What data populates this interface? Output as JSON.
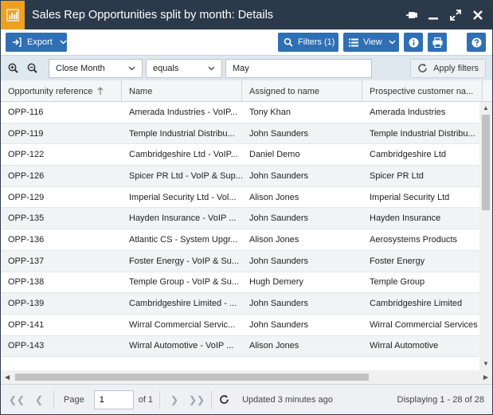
{
  "window": {
    "title": "Sales Rep Opportunities split by month: Details"
  },
  "toolbar": {
    "export_label": "Export",
    "filters_label": "Filters (1)",
    "view_label": "View"
  },
  "filter": {
    "field": "Close Month",
    "operator": "equals",
    "value": "May",
    "apply_label": "Apply filters"
  },
  "grid": {
    "columns": [
      "Opportunity reference",
      "Name",
      "Assigned to name",
      "Prospective customer na..."
    ],
    "rows": [
      [
        "OPP-116",
        "Amerada Industries - VoIP...",
        "Tony Khan",
        "Amerada Industries"
      ],
      [
        "OPP-119",
        "Temple Industrial Distribu...",
        "John Saunders",
        "Temple Industrial Distribu..."
      ],
      [
        "OPP-122",
        "Cambridgeshire Ltd - VoIP...",
        "Daniel Demo",
        "Cambridgeshire Ltd"
      ],
      [
        "OPP-126",
        "Spicer PR Ltd - VoIP & Sup...",
        "John Saunders",
        "Spicer PR Ltd"
      ],
      [
        "OPP-129",
        "Imperial Security Ltd - Vol...",
        "Alison Jones",
        "Imperial Security Ltd"
      ],
      [
        "OPP-135",
        "Hayden Insurance - VoIP ...",
        "John Saunders",
        "Hayden Insurance"
      ],
      [
        "OPP-136",
        "Atlantic CS - System Upgr...",
        "Alison Jones",
        "Aerosystems Products"
      ],
      [
        "OPP-137",
        "Foster Energy - VoIP & Su...",
        "John Saunders",
        "Foster Energy"
      ],
      [
        "OPP-138",
        "Temple Group - VoIP & Su...",
        "Hugh Demery",
        "Temple Group"
      ],
      [
        "OPP-139",
        "Cambridgeshire Limited - ...",
        "John Saunders",
        "Cambridgeshire Limited"
      ],
      [
        "OPP-141",
        "Wirral Commercial Servic...",
        "John Saunders",
        "Wirral Commercial Services"
      ],
      [
        "OPP-143",
        "Wirral Automotive - VoIP ...",
        "Alison Jones",
        "Wirral Automotive"
      ]
    ]
  },
  "pager": {
    "page_label": "Page",
    "page_value": "1",
    "of_label": "of 1",
    "updated": "Updated 3 minutes ago",
    "displaying": "Displaying 1 - 28 of 28"
  },
  "colors": {
    "titlebar": "#2b3a4a",
    "accent": "#2f6fb4",
    "app_icon": "#f0a020"
  }
}
